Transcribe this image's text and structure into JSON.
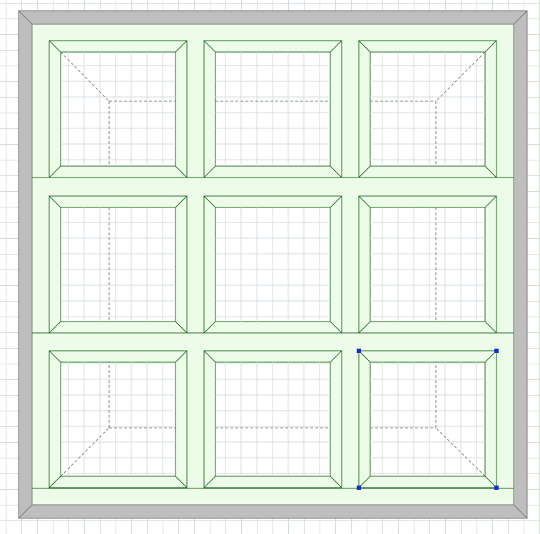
{
  "canvas": {
    "description_free": true,
    "colors": {
      "background": "#ffffff",
      "grid_line": "#d2ddd2",
      "wall_fill": "#bebebe",
      "wall_stroke": "#777777",
      "floor_fill": "#edfbe9",
      "cabinet_stroke": "#1a6b1a",
      "inner_fill": "#ffffff",
      "hidden_line": "#777777",
      "selection_handle": "#1030d0"
    }
  },
  "cabinet_grid": {
    "rows": 3,
    "columns": 3,
    "selected_cell": {
      "row": 3,
      "column": 3
    }
  },
  "icons": [
    "selection-handle-icon"
  ]
}
